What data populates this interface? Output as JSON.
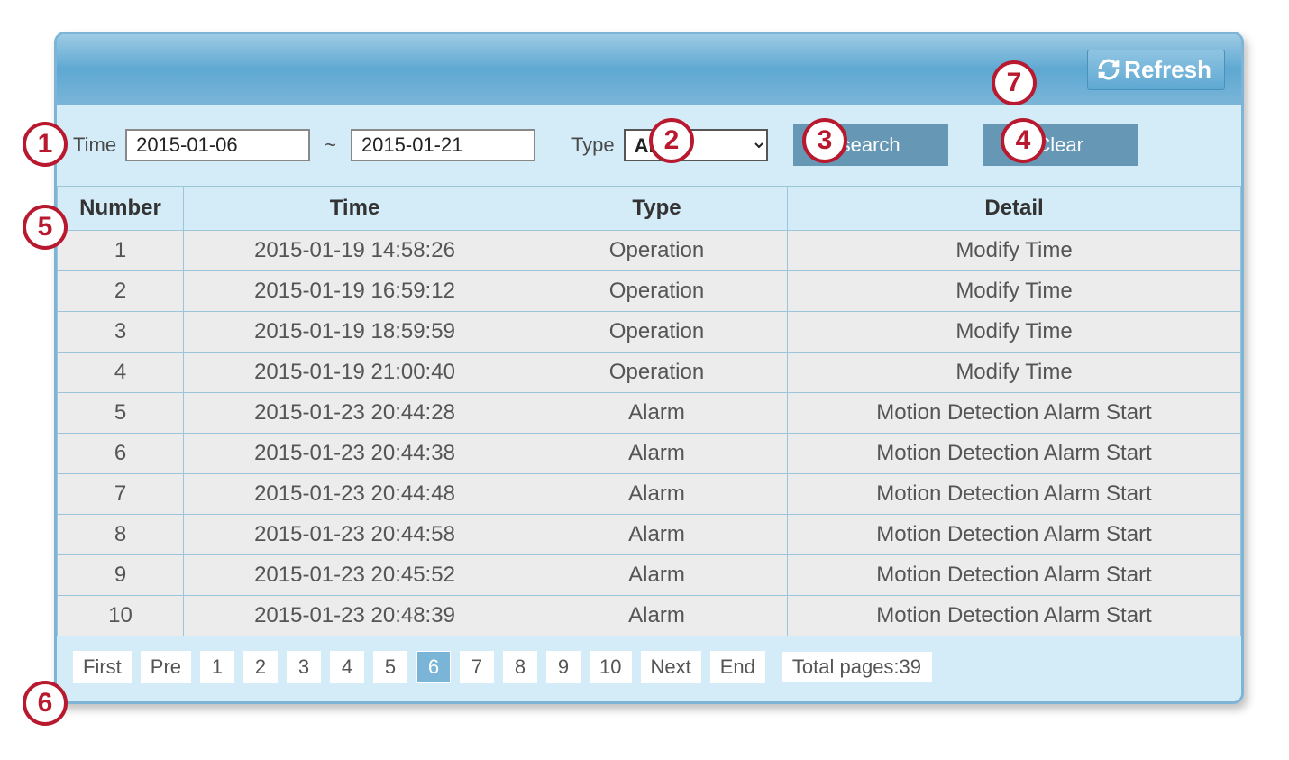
{
  "header": {
    "refresh_label": "Refresh"
  },
  "filter": {
    "time_label": "Time",
    "date_from": "2015-01-06",
    "tilde": "~",
    "date_to": "2015-01-21",
    "type_label": "Type",
    "type_selected": "All",
    "search_label": "search",
    "clear_label": "Clear"
  },
  "table": {
    "headers": {
      "number": "Number",
      "time": "Time",
      "type": "Type",
      "detail": "Detail"
    },
    "rows": [
      {
        "number": "1",
        "time": "2015-01-19 14:58:26",
        "type": "Operation",
        "detail": "Modify Time"
      },
      {
        "number": "2",
        "time": "2015-01-19 16:59:12",
        "type": "Operation",
        "detail": "Modify Time"
      },
      {
        "number": "3",
        "time": "2015-01-19 18:59:59",
        "type": "Operation",
        "detail": "Modify Time"
      },
      {
        "number": "4",
        "time": "2015-01-19 21:00:40",
        "type": "Operation",
        "detail": "Modify Time"
      },
      {
        "number": "5",
        "time": "2015-01-23 20:44:28",
        "type": "Alarm",
        "detail": "Motion Detection Alarm Start"
      },
      {
        "number": "6",
        "time": "2015-01-23 20:44:38",
        "type": "Alarm",
        "detail": "Motion Detection Alarm Start"
      },
      {
        "number": "7",
        "time": "2015-01-23 20:44:48",
        "type": "Alarm",
        "detail": "Motion Detection Alarm Start"
      },
      {
        "number": "8",
        "time": "2015-01-23 20:44:58",
        "type": "Alarm",
        "detail": "Motion Detection Alarm Start"
      },
      {
        "number": "9",
        "time": "2015-01-23 20:45:52",
        "type": "Alarm",
        "detail": "Motion Detection Alarm Start"
      },
      {
        "number": "10",
        "time": "2015-01-23 20:48:39",
        "type": "Alarm",
        "detail": "Motion Detection Alarm Start"
      }
    ]
  },
  "pager": {
    "first": "First",
    "pre": "Pre",
    "pages": [
      "1",
      "2",
      "3",
      "4",
      "5",
      "6",
      "7",
      "8",
      "9",
      "10"
    ],
    "current": "6",
    "next": "Next",
    "end": "End",
    "total": "Total pages:39"
  },
  "annotations": {
    "a1": "1",
    "a2": "2",
    "a3": "3",
    "a4": "4",
    "a5": "5",
    "a6": "6",
    "a7": "7"
  }
}
